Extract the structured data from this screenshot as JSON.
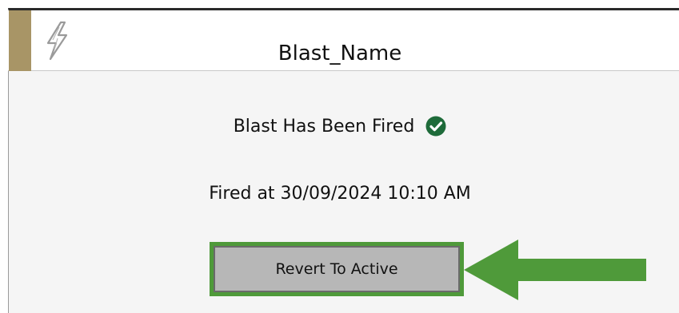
{
  "window": {
    "title": "Blast_Name",
    "icon": "lightning-bolt-icon"
  },
  "status": {
    "text": "Blast Has Been Fired",
    "icon": "check-circle-icon",
    "icon_color": "#1e6b3a"
  },
  "fired": {
    "text": "Fired at 30/09/2024 10:10 AM"
  },
  "actions": {
    "revert_label": "Revert To Active"
  },
  "annotation": {
    "icon": "arrow-left-icon",
    "color": "#4f9a3a"
  }
}
